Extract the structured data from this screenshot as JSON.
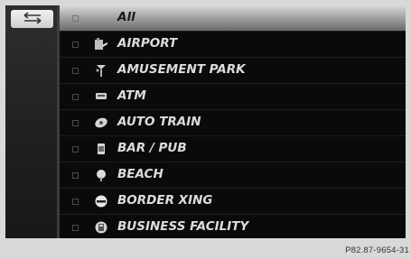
{
  "nav": {
    "back_icon": "back-arrows-icon"
  },
  "list": {
    "items": [
      {
        "label": "All",
        "icon": "",
        "selected": true
      },
      {
        "label": "AIRPORT",
        "icon": "airport-icon",
        "selected": false
      },
      {
        "label": "AMUSEMENT PARK",
        "icon": "amusement-park-icon",
        "selected": false
      },
      {
        "label": "ATM",
        "icon": "atm-icon",
        "selected": false
      },
      {
        "label": "AUTO TRAIN",
        "icon": "auto-train-icon",
        "selected": false
      },
      {
        "label": "BAR / PUB",
        "icon": "bar-pub-icon",
        "selected": false
      },
      {
        "label": "BEACH",
        "icon": "beach-icon",
        "selected": false
      },
      {
        "label": "BORDER XING",
        "icon": "border-crossing-icon",
        "selected": false
      },
      {
        "label": "BUSINESS FACILITY",
        "icon": "business-facility-icon",
        "selected": false
      }
    ]
  },
  "caption": "P82.87-9654-31"
}
